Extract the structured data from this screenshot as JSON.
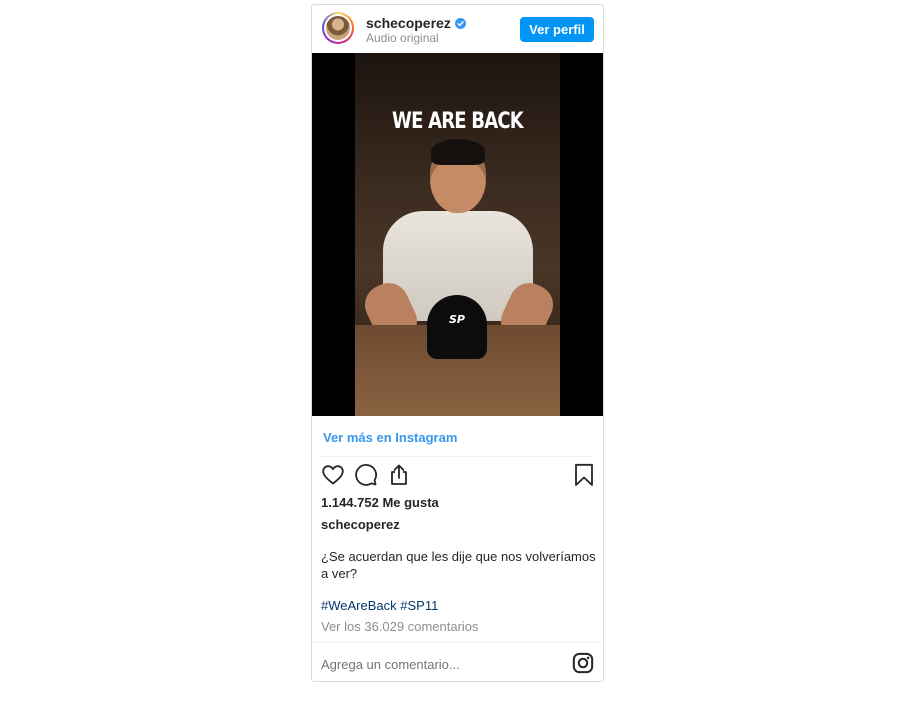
{
  "header": {
    "username": "schecoperez",
    "subtitle": "Audio original",
    "view_profile_label": "Ver perfil"
  },
  "media": {
    "overlay_text": "WE ARE BACK",
    "cap_logo": "SP"
  },
  "post": {
    "view_more_label": "Ver más en Instagram",
    "likes": "1.144.752 Me gusta",
    "caption_user": "schecoperez",
    "caption": "¿Se acuerdan que les dije que nos volveríamos a ver?",
    "hashtags": [
      "#WeAreBack",
      "#SP11"
    ],
    "view_comments": "Ver los 36.029 comentarios"
  },
  "comment": {
    "placeholder": "Agrega un comentario..."
  },
  "colors": {
    "accent": "#0095f6",
    "link": "#3897f0",
    "hashtag": "#00376b",
    "verified": "#3897f0"
  },
  "icons": [
    "verified-icon",
    "heart-icon",
    "comment-icon",
    "share-icon",
    "bookmark-icon",
    "instagram-icon"
  ]
}
